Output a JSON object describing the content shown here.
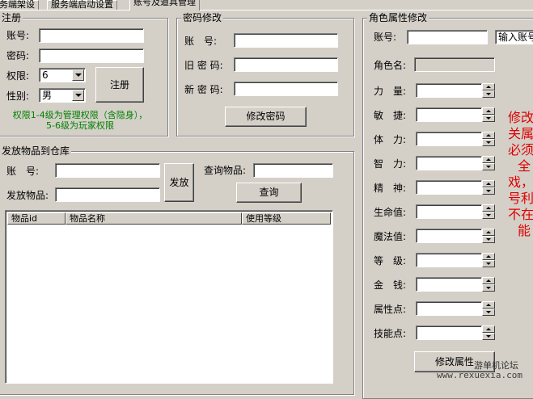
{
  "tabs": [
    "务端架设",
    "服务端启动设置",
    "账号及道具管理"
  ],
  "register": {
    "title": "注册",
    "account_label": "账号:",
    "password_label": "密码:",
    "permission_label": "权限:",
    "permission_value": "6",
    "gender_label": "性别:",
    "gender_value": "男",
    "register_button": "注册",
    "note": "权限1-4级为管理权限（含隐身），5-6级为玩家权限"
  },
  "password_change": {
    "title": "密码修改",
    "account_label": "账　号:",
    "old_label": "旧 密 码:",
    "new_label": "新 密 码:",
    "button": "修改密码"
  },
  "issue_items": {
    "title": "发放物品到仓库",
    "account_label": "账　号:",
    "item_label": "发放物品:",
    "issue_button": "发放",
    "query_label": "查询物品:",
    "query_button": "查询",
    "columns": [
      "物品id",
      "物品名称",
      "使用等级"
    ]
  },
  "role_attr": {
    "title": "角色属性修改",
    "account_label": "账号:",
    "account_hint": "输入账号",
    "role_name_label": "角色名:",
    "fields": [
      "力　量:",
      "敏　捷:",
      "体　力:",
      "智　力:",
      "精　神:",
      "生命值:",
      "魔法值:",
      "等　级:",
      "金　钱:",
      "属性点:",
      "技能点:"
    ],
    "modify_button": "修改属性",
    "warning_lines": [
      "修改",
      "关属",
      "必须",
      "全",
      "戏，",
      "号利",
      "不在",
      "能"
    ]
  },
  "watermark": {
    "text1": "游单机论坛",
    "text2": "www.rexuexia.com"
  },
  "colors": {
    "window_bg": "#d4d0c8",
    "note_green": "#008000",
    "warning_red": "#e00000"
  }
}
